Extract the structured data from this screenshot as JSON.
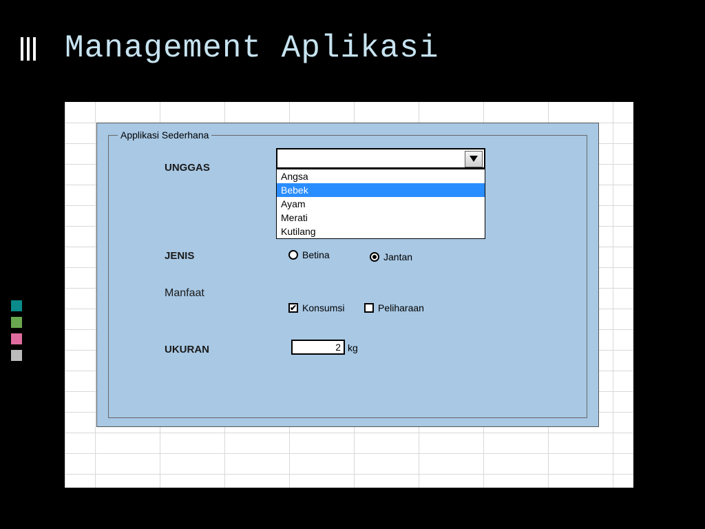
{
  "slide_title": "Management Aplikasi",
  "form": {
    "legend": "Applikasi Sederhana",
    "rows": {
      "unggas_label": "UNGGAS",
      "jenis_label": "JENIS",
      "manfaat_label": "Manfaat",
      "ukuran_label": "UKURAN"
    },
    "unggas": {
      "selected": "",
      "options": [
        "Angsa",
        "Bebek",
        "Ayam",
        "Merati",
        "Kutilang"
      ],
      "highlighted_index": 1
    },
    "jenis": {
      "betina": {
        "label": "Betina",
        "checked": false
      },
      "jantan": {
        "label": "Jantan",
        "checked": true
      }
    },
    "manfaat": {
      "konsumsi": {
        "label": "Konsumsi",
        "checked": true
      },
      "peliharaan": {
        "label": "Peliharaan",
        "checked": false
      }
    },
    "ukuran": {
      "value": "2",
      "unit": "kg"
    }
  }
}
